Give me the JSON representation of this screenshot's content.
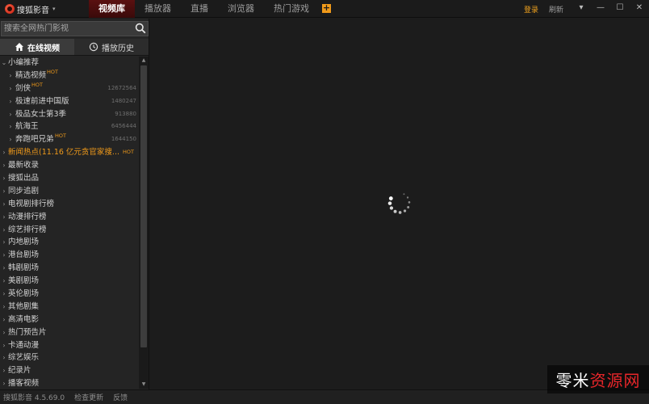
{
  "app": {
    "name": "搜狐影音",
    "nav_tabs": [
      "视频库",
      "播放器",
      "直播",
      "浏览器",
      "热门游戏"
    ],
    "login": "登录",
    "refresh": "刷新",
    "window_buttons": [
      "▾",
      "—",
      "☐",
      "✕"
    ]
  },
  "search": {
    "placeholder": "搜索全网热门影视"
  },
  "tabs": {
    "online": "在线视频",
    "history": "播放历史"
  },
  "tree": [
    {
      "label": "小编推荐",
      "hot": "",
      "count": "",
      "expanded": true,
      "indent": false
    },
    {
      "label": "精选视频",
      "hot": "HOT",
      "count": "",
      "indent": true
    },
    {
      "label": "剑侠",
      "hot": "HOT",
      "count": "12672564",
      "indent": true
    },
    {
      "label": "极速前进中国版",
      "hot": "",
      "count": "1480247",
      "indent": true
    },
    {
      "label": "极品女士第3季",
      "hot": "",
      "count": "913880",
      "indent": true
    },
    {
      "label": "航海王",
      "hot": "",
      "count": "6456444",
      "indent": true
    },
    {
      "label": "奔跑吧兄弟",
      "hot": "HOT",
      "count": "1644150",
      "indent": true
    },
    {
      "label": "新闻热点(11.16 亿元贪官家搜...",
      "hot": "HOT",
      "count": "",
      "indent": false,
      "orange": true
    },
    {
      "label": "最新收录",
      "hot": "",
      "count": "",
      "indent": false
    },
    {
      "label": "搜狐出品",
      "hot": "",
      "count": "",
      "indent": false
    },
    {
      "label": "同步追剧",
      "hot": "",
      "count": "",
      "indent": false
    },
    {
      "label": "电视剧排行榜",
      "hot": "",
      "count": "",
      "indent": false
    },
    {
      "label": "动漫排行榜",
      "hot": "",
      "count": "",
      "indent": false
    },
    {
      "label": "综艺排行榜",
      "hot": "",
      "count": "",
      "indent": false
    },
    {
      "label": "内地剧场",
      "hot": "",
      "count": "",
      "indent": false
    },
    {
      "label": "港台剧场",
      "hot": "",
      "count": "",
      "indent": false
    },
    {
      "label": "韩剧剧场",
      "hot": "",
      "count": "",
      "indent": false
    },
    {
      "label": "美剧剧场",
      "hot": "",
      "count": "",
      "indent": false
    },
    {
      "label": "英伦剧场",
      "hot": "",
      "count": "",
      "indent": false
    },
    {
      "label": "其他剧集",
      "hot": "",
      "count": "",
      "indent": false
    },
    {
      "label": "高清电影",
      "hot": "",
      "count": "",
      "indent": false
    },
    {
      "label": "热门预告片",
      "hot": "",
      "count": "",
      "indent": false
    },
    {
      "label": "卡通动漫",
      "hot": "",
      "count": "",
      "indent": false
    },
    {
      "label": "综艺娱乐",
      "hot": "",
      "count": "",
      "indent": false
    },
    {
      "label": "纪录片",
      "hot": "",
      "count": "",
      "indent": false
    },
    {
      "label": "播客视频",
      "hot": "",
      "count": "",
      "indent": false
    }
  ],
  "statusbar": {
    "version": "搜狐影音 4.5.69.0",
    "check_update": "检查更新",
    "feedback": "反馈"
  },
  "watermark": {
    "part1": "零米",
    "part2": "资源网"
  },
  "colors": {
    "accent": "#f09a1a",
    "active_tab": "#5a1010",
    "background": "#1c1c1c"
  },
  "icons": {
    "search": "search-icon",
    "home": "home-icon",
    "history": "clock-icon",
    "spinner": "loading-spinner"
  }
}
